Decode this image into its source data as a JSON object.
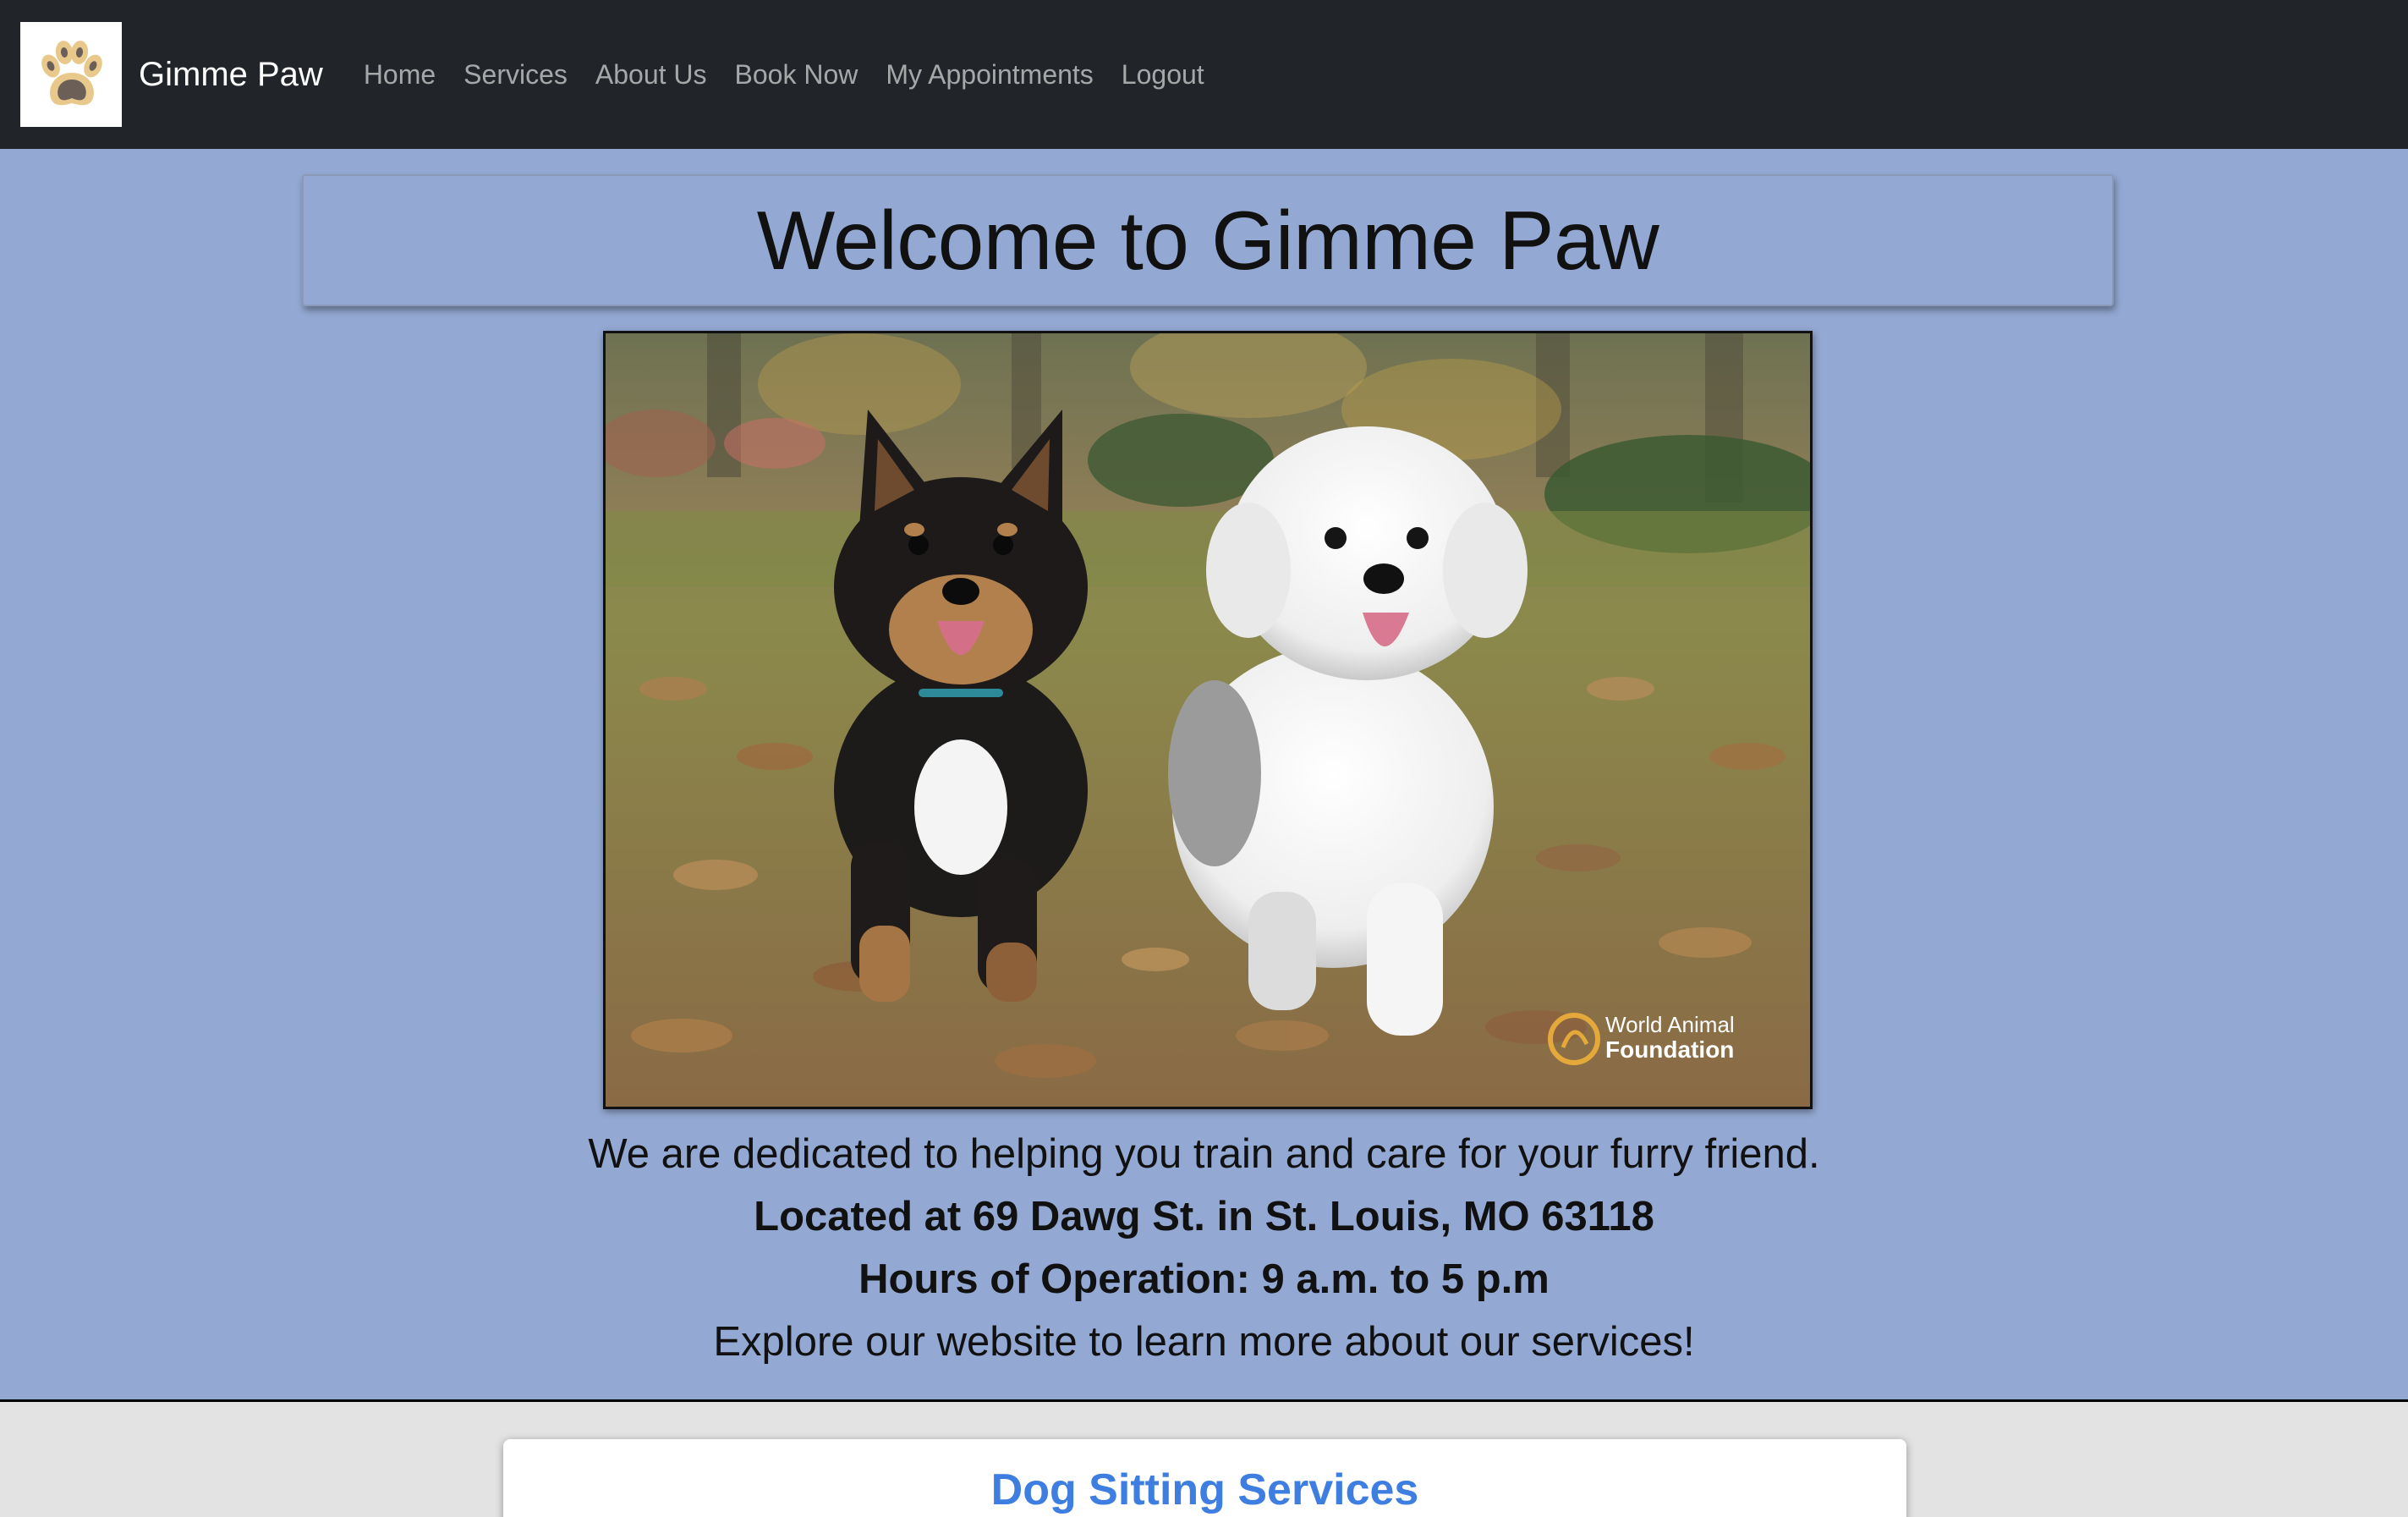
{
  "nav": {
    "brand_name": "Gimme Paw",
    "logo_icon": "paw-icon",
    "links": [
      {
        "label": "Home"
      },
      {
        "label": "Services"
      },
      {
        "label": "About Us"
      },
      {
        "label": "Book Now"
      },
      {
        "label": "My Appointments"
      },
      {
        "label": "Logout"
      }
    ]
  },
  "hero": {
    "title": "Welcome to Gimme Paw",
    "image": {
      "subject": "two puppies running on autumn leaves",
      "watermark_line1": "World Animal",
      "watermark_line2": "Foundation"
    },
    "lines": [
      "We are dedicated to helping you train and care for your furry friend.",
      "Located at 69 Dawg St. in St. Louis, MO 63118",
      "Hours of Operation: 9 a.m. to 5 p.m",
      "Explore our website to learn more about our services!"
    ]
  },
  "services": {
    "first_card_title": "Dog Sitting Services"
  },
  "colors": {
    "navbar_bg": "#212529",
    "page_bg": "#93a8d2",
    "service_title": "#3d7ee0",
    "services_bg": "#e3e3e3"
  }
}
